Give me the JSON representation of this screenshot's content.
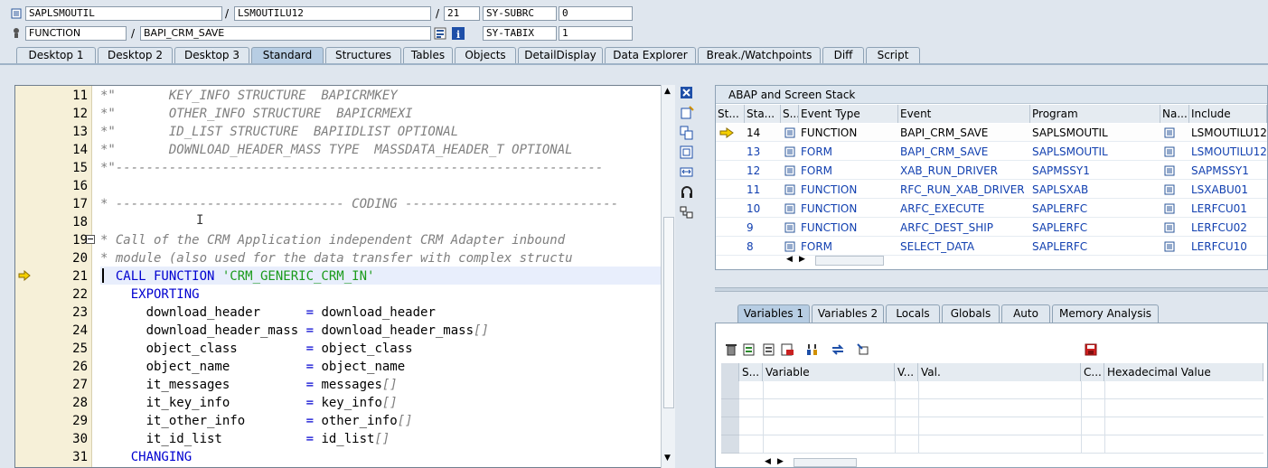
{
  "header": {
    "program": "SAPLSMOUTIL",
    "include": "LSMOUTILU12",
    "line": "21",
    "sysubrc_label": "SY-SUBRC",
    "sysubrc_value": "0",
    "event_type": "FUNCTION",
    "event": "BAPI_CRM_SAVE",
    "sytabix_label": "SY-TABIX",
    "sytabix_value": "1",
    "sep": "/"
  },
  "tabs": [
    "Desktop 1",
    "Desktop 2",
    "Desktop 3",
    "Standard",
    "Structures",
    "Tables",
    "Objects",
    "DetailDisplay",
    "Data Explorer",
    "Break./Watchpoints",
    "Diff",
    "Script"
  ],
  "active_tab": "Standard",
  "editor": {
    "lines": [
      {
        "n": "11",
        "parts": [
          {
            "c": "cmt",
            "t": "*\"       KEY_INFO STRUCTURE  BAPICRMKEY"
          }
        ]
      },
      {
        "n": "12",
        "parts": [
          {
            "c": "cmt",
            "t": "*\"       OTHER_INFO STRUCTURE  BAPICRMEXI"
          }
        ]
      },
      {
        "n": "13",
        "parts": [
          {
            "c": "cmt",
            "t": "*\"       ID_LIST STRUCTURE  BAPIIDLIST OPTIONAL"
          }
        ]
      },
      {
        "n": "14",
        "parts": [
          {
            "c": "cmt",
            "t": "*\"       DOWNLOAD_HEADER_MASS TYPE  MASSDATA_HEADER_T OPTIONAL"
          }
        ]
      },
      {
        "n": "15",
        "parts": [
          {
            "c": "cmt",
            "t": "*\"----------------------------------------------------------------"
          }
        ]
      },
      {
        "n": "16",
        "parts": [
          {
            "c": "plain",
            "t": ""
          }
        ]
      },
      {
        "n": "17",
        "parts": [
          {
            "c": "cmt",
            "t": "* ------------------------------ CODING ----------------------------"
          }
        ]
      },
      {
        "n": "18",
        "parts": [
          {
            "c": "plain",
            "t": ""
          }
        ]
      },
      {
        "n": "19",
        "parts": [
          {
            "c": "cmt",
            "t": "* Call of the CRM Application independent CRM Adapter inbound"
          }
        ]
      },
      {
        "n": "20",
        "parts": [
          {
            "c": "cmt",
            "t": "* module (also used for the data transfer with complex structu"
          }
        ]
      },
      {
        "n": "21",
        "parts": [
          {
            "c": "kw",
            "t": "  CALL FUNCTION "
          },
          {
            "c": "str",
            "t": "'CRM_GENERIC_CRM_IN'"
          }
        ]
      },
      {
        "n": "22",
        "parts": [
          {
            "c": "kw",
            "t": "    EXPORTING"
          }
        ]
      },
      {
        "n": "23",
        "parts": [
          {
            "c": "plain",
            "t": "      download_header      "
          },
          {
            "c": "kw",
            "t": "= "
          },
          {
            "c": "plain",
            "t": "download_header"
          }
        ]
      },
      {
        "n": "24",
        "parts": [
          {
            "c": "plain",
            "t": "      download_header_mass "
          },
          {
            "c": "kw",
            "t": "= "
          },
          {
            "c": "plain",
            "t": "download_header_mass"
          },
          {
            "c": "cmt",
            "t": "[]"
          }
        ]
      },
      {
        "n": "25",
        "parts": [
          {
            "c": "plain",
            "t": "      object_class         "
          },
          {
            "c": "kw",
            "t": "= "
          },
          {
            "c": "plain",
            "t": "object_class"
          }
        ]
      },
      {
        "n": "26",
        "parts": [
          {
            "c": "plain",
            "t": "      object_name          "
          },
          {
            "c": "kw",
            "t": "= "
          },
          {
            "c": "plain",
            "t": "object_name"
          }
        ]
      },
      {
        "n": "27",
        "parts": [
          {
            "c": "plain",
            "t": "      it_messages          "
          },
          {
            "c": "kw",
            "t": "= "
          },
          {
            "c": "plain",
            "t": "messages"
          },
          {
            "c": "cmt",
            "t": "[]"
          }
        ]
      },
      {
        "n": "28",
        "parts": [
          {
            "c": "plain",
            "t": "      it_key_info          "
          },
          {
            "c": "kw",
            "t": "= "
          },
          {
            "c": "plain",
            "t": "key_info"
          },
          {
            "c": "cmt",
            "t": "[]"
          }
        ]
      },
      {
        "n": "29",
        "parts": [
          {
            "c": "plain",
            "t": "      it_other_info        "
          },
          {
            "c": "kw",
            "t": "= "
          },
          {
            "c": "plain",
            "t": "other_info"
          },
          {
            "c": "cmt",
            "t": "[]"
          }
        ]
      },
      {
        "n": "30",
        "parts": [
          {
            "c": "plain",
            "t": "      it_id_list           "
          },
          {
            "c": "kw",
            "t": "= "
          },
          {
            "c": "plain",
            "t": "id_list"
          },
          {
            "c": "cmt",
            "t": "[]"
          }
        ]
      },
      {
        "n": "31",
        "parts": [
          {
            "c": "kw",
            "t": "    CHANGING"
          }
        ]
      }
    ]
  },
  "stack": {
    "title": "ABAP and Screen Stack",
    "columns": [
      "St...",
      "Sta...",
      "S...",
      "Event Type",
      "Event",
      "Program",
      "Na...",
      "Include"
    ],
    "rows": [
      {
        "level": "14",
        "type": "FUNCTION",
        "event": "BAPI_CRM_SAVE",
        "program": "SAPLSMOUTIL",
        "include": "LSMOUTILU12",
        "current": true
      },
      {
        "level": "13",
        "type": "FORM",
        "event": "BAPI_CRM_SAVE",
        "program": "SAPLSMOUTIL",
        "include": "LSMOUTILU12",
        "current": false
      },
      {
        "level": "12",
        "type": "FORM",
        "event": "XAB_RUN_DRIVER",
        "program": "SAPMSSY1",
        "include": "SAPMSSY1",
        "current": false
      },
      {
        "level": "11",
        "type": "FUNCTION",
        "event": "RFC_RUN_XAB_DRIVER",
        "program": "SAPLSXAB",
        "include": "LSXABU01",
        "current": false
      },
      {
        "level": "10",
        "type": "FUNCTION",
        "event": "ARFC_EXECUTE",
        "program": "SAPLERFC",
        "include": "LERFCU01",
        "current": false
      },
      {
        "level": "9",
        "type": "FUNCTION",
        "event": "ARFC_DEST_SHIP",
        "program": "SAPLERFC",
        "include": "LERFCU02",
        "current": false
      },
      {
        "level": "8",
        "type": "FORM",
        "event": "SELECT_DATA",
        "program": "SAPLERFC",
        "include": "LERFCU10",
        "current": false
      }
    ]
  },
  "var_tabs": [
    "Variables 1",
    "Variables 2",
    "Locals",
    "Globals",
    "Auto",
    "Memory Analysis"
  ],
  "active_var_tab": "Variables 1",
  "vars": {
    "columns": [
      "S...",
      "Variable",
      "V...",
      "Val.",
      "C...",
      "Hexadecimal Value"
    ]
  },
  "colors": {
    "accent": "#b7cde3",
    "keyword": "#0000d0",
    "string": "#1a9a1a",
    "comment": "#7f7f7f"
  },
  "icons": [
    "program-icon",
    "function-icon",
    "search-help-icon",
    "info-icon",
    "current-line-arrow-icon",
    "close-icon",
    "new-icon",
    "copy-icon",
    "maximize-icon",
    "full-width-icon",
    "headset-icon",
    "layout-icon",
    "delete-icon",
    "save-icon"
  ]
}
